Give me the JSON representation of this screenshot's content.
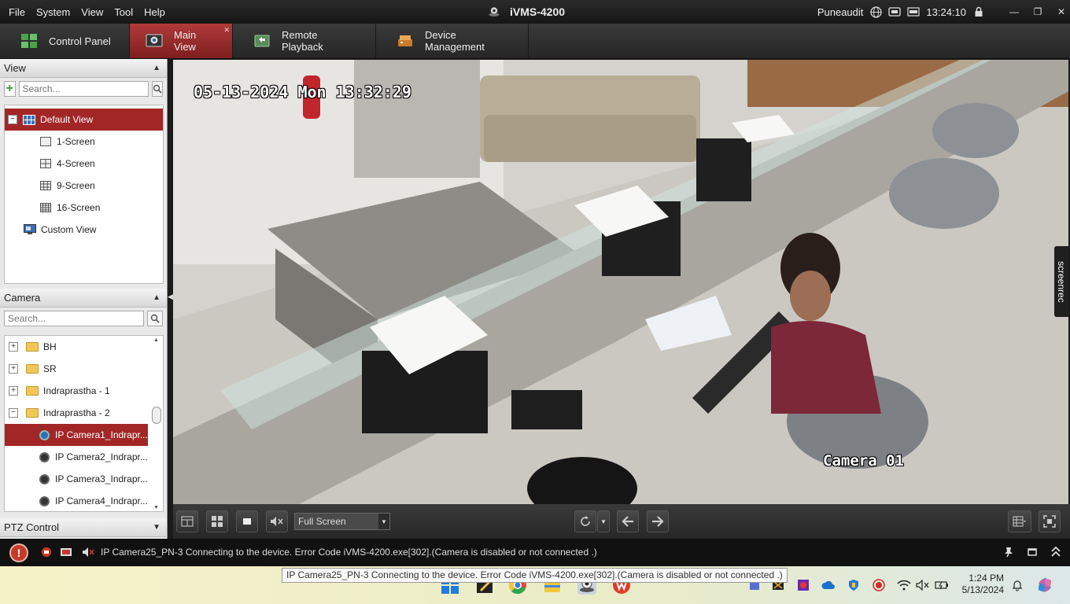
{
  "menubar": {
    "menus": [
      "File",
      "System",
      "View",
      "Tool",
      "Help"
    ],
    "app_title": "iVMS-4200",
    "user": "Puneaudit",
    "time": "13:24:10"
  },
  "tabs": [
    {
      "label": "Control Panel"
    },
    {
      "label": "Main View"
    },
    {
      "label": "Remote Playback"
    },
    {
      "label": "Device Management"
    }
  ],
  "view_panel": {
    "title": "View",
    "search_placeholder": "Search...",
    "items": [
      {
        "label": "Default View"
      },
      {
        "label": "1-Screen"
      },
      {
        "label": "4-Screen"
      },
      {
        "label": "9-Screen"
      },
      {
        "label": "16-Screen"
      },
      {
        "label": "Custom View"
      }
    ]
  },
  "camera_panel": {
    "title": "Camera",
    "search_placeholder": "Search...",
    "groups": [
      {
        "label": "BH"
      },
      {
        "label": "SR"
      },
      {
        "label": "Indraprastha - 1"
      },
      {
        "label": "Indraprastha - 2"
      }
    ],
    "cameras": [
      {
        "label": "IP Camera1_Indrapr..."
      },
      {
        "label": "IP Camera2_Indrapr..."
      },
      {
        "label": "IP Camera3_Indrapr..."
      },
      {
        "label": "IP Camera4_Indrapr..."
      }
    ]
  },
  "ptz": {
    "title": "PTZ Control"
  },
  "video": {
    "timestamp": "05-13-2024 Mon 13:32:29",
    "camera_label": "Camera 01",
    "overlay_badge": "screenrec"
  },
  "video_toolbar": {
    "display_mode": "Full Screen"
  },
  "status": {
    "message": "IP Camera25_PN-3 Connecting to the device. Error Code iVMS-4200.exe[302].(Camera is disabled or not connected .)"
  },
  "tooltip": {
    "text": "IP Camera25_PN-3 Connecting to the device. Error Code iVMS-4200.exe[302].(Camera is disabled or not connected .)"
  },
  "taskbar": {
    "time": "1:24 PM",
    "date": "5/13/2024"
  },
  "colors": {
    "accent_red": "#a32626",
    "toolbar_dark": "#2a2a2a"
  }
}
